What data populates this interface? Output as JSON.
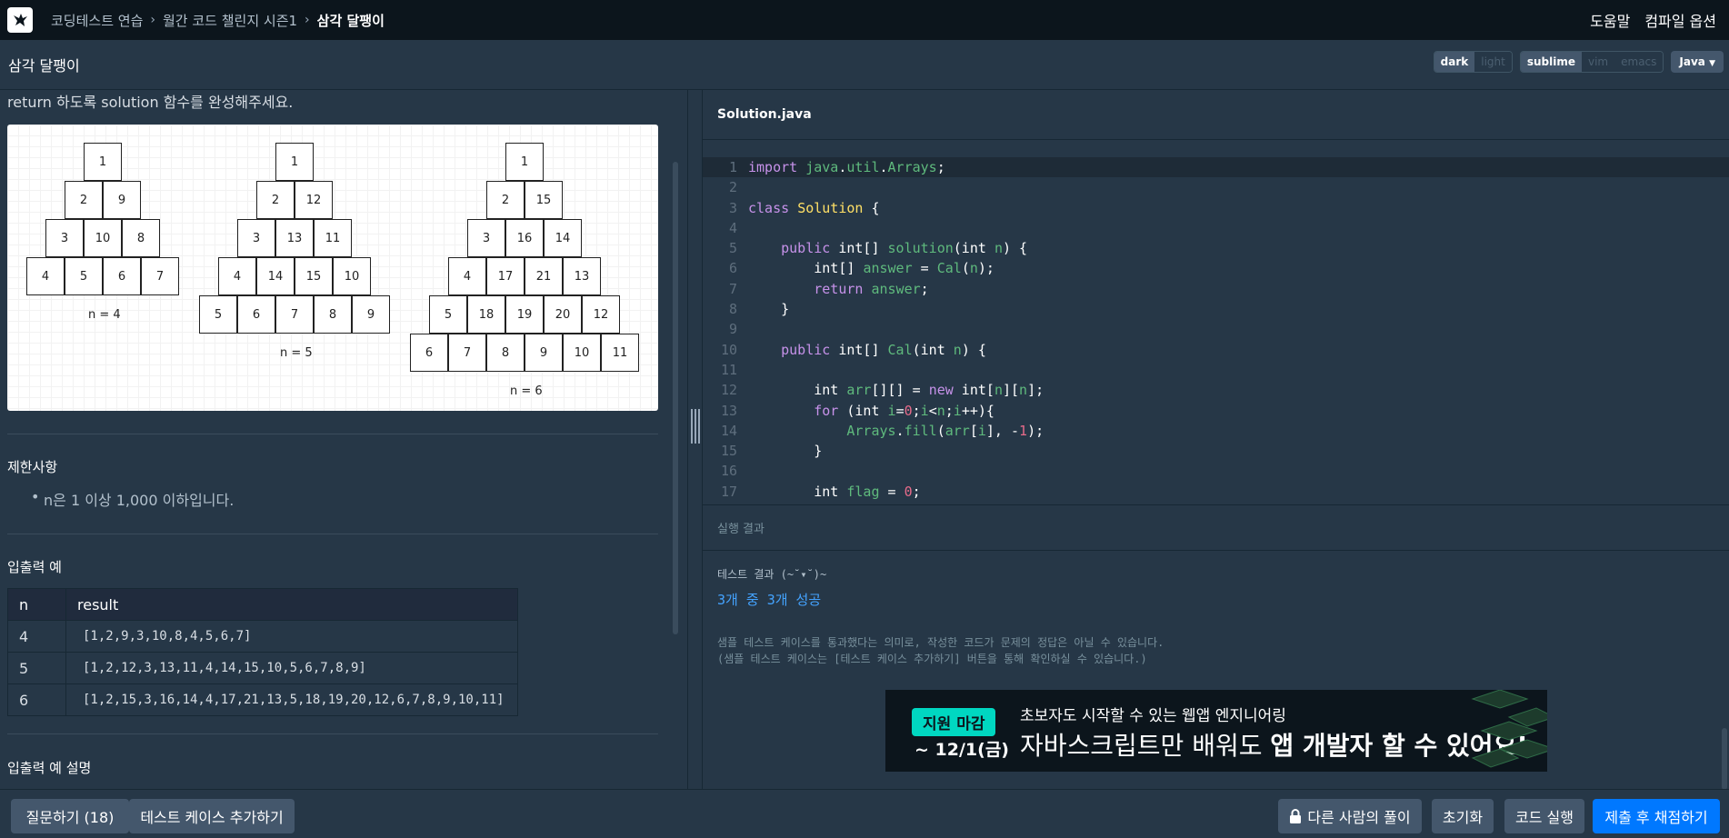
{
  "topnav": {
    "crumbs": [
      "코딩테스트 연습",
      "월간 코드 챌린지 시즌1",
      "삼각 달팽이"
    ],
    "help": "도움말",
    "compile_options": "컴파일 옵션"
  },
  "lesson": {
    "title": "삼각 달팽이",
    "theme": [
      "dark",
      "light"
    ],
    "keymap": [
      "sublime",
      "vim",
      "emacs"
    ],
    "language": "Java"
  },
  "problem": {
    "intro_tail": "return 하도록 solution 함수를 완성해주세요.",
    "figure": {
      "triangles": [
        {
          "label": "n = 4",
          "rows": [
            [
              "1"
            ],
            [
              "2",
              "9"
            ],
            [
              "3",
              "10",
              "8"
            ],
            [
              "4",
              "5",
              "6",
              "7"
            ]
          ]
        },
        {
          "label": "n = 5",
          "rows": [
            [
              "1"
            ],
            [
              "2",
              "12"
            ],
            [
              "3",
              "13",
              "11"
            ],
            [
              "4",
              "14",
              "15",
              "10"
            ],
            [
              "5",
              "6",
              "7",
              "8",
              "9"
            ]
          ]
        },
        {
          "label": "n = 6",
          "rows": [
            [
              "1"
            ],
            [
              "2",
              "15"
            ],
            [
              "3",
              "16",
              "14"
            ],
            [
              "4",
              "17",
              "21",
              "13"
            ],
            [
              "5",
              "18",
              "19",
              "20",
              "12"
            ],
            [
              "6",
              "7",
              "8",
              "9",
              "10",
              "11"
            ]
          ]
        }
      ]
    },
    "constraints_title": "제한사항",
    "constraints": [
      "n은 1 이상 1,000 이하입니다."
    ],
    "io_title": "입출력 예",
    "io_headers": [
      "n",
      "result"
    ],
    "io_rows": [
      {
        "n": "4",
        "result": "[1,2,9,3,10,8,4,5,6,7]"
      },
      {
        "n": "5",
        "result": "[1,2,12,3,13,11,4,14,15,10,5,6,7,8,9]"
      },
      {
        "n": "6",
        "result": "[1,2,15,3,16,14,4,17,21,13,5,18,19,20,12,6,7,8,9,10,11]"
      }
    ],
    "io_desc_title": "입출력 예 설명"
  },
  "editor": {
    "filename": "Solution.java",
    "line_numbers": [
      "1",
      "2",
      "3",
      "4",
      "5",
      "6",
      "7",
      "8",
      "9",
      "10",
      "11",
      "12",
      "13",
      "14",
      "15",
      "16",
      "17"
    ]
  },
  "output": {
    "header": "실행 결과",
    "result_title": "테스트 결과 (~˘▾˘)~",
    "result_summary": "3개 중 3개 성공",
    "note1": "샘플 테스트 케이스를 통과했다는 의미로, 작성한 코드가 문제의 정답은 아닐 수 있습니다.",
    "note2": "(샘플 테스트 케이스는 [테스트 케이스 추가하기] 버튼을 통해 확인하실 수 있습니다.)",
    "banner": {
      "badge": "지원 마감",
      "deadline": "~ 12/1(금)",
      "sub": "초보자도 시작할 수 있는 웹앱 엔지니어링",
      "main_prefix": "자바스크립트만 배워도 ",
      "main_bold": "앱 개발자 할 수 있어요!"
    }
  },
  "footer": {
    "ask": "질문하기 (18)",
    "add_case": "테스트 케이스 추가하기",
    "others": "다른 사람의 풀이",
    "reset": "초기화",
    "run": "코드 실행",
    "submit": "제출 후 채점하기"
  },
  "colors": {
    "accent": "#0078ff",
    "badge": "#00d7c1",
    "bg": "#263747",
    "nav": "#0c151c"
  }
}
